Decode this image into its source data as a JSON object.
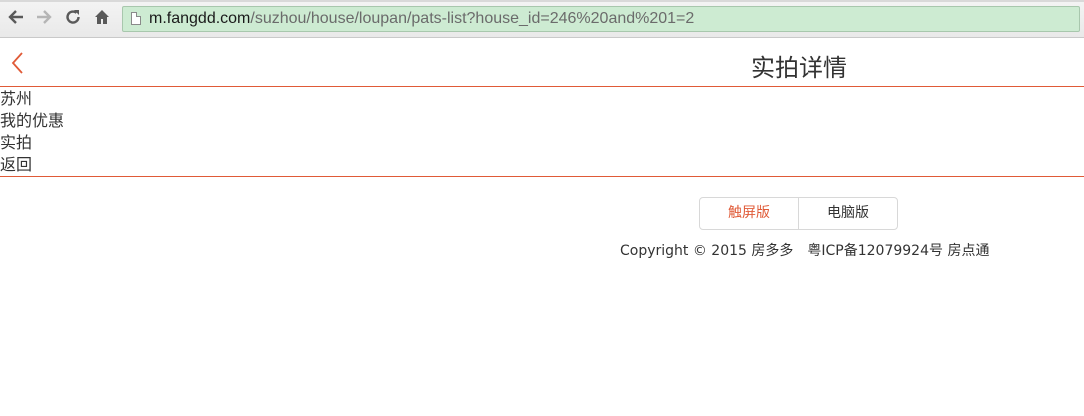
{
  "browser": {
    "back_glyph": "🡐",
    "forward_glyph": "🡒",
    "reload_glyph": "↻",
    "home_glyph": "⌂",
    "url_host": "m.fangdd.com",
    "url_path": "/suzhou/house/loupan/pats-list?house_id=246%20and%201=2",
    "omnibox_color": "#cdebd2"
  },
  "header": {
    "back_icon": "chevron-left-icon",
    "title": "实拍详情",
    "accent_color": "#e05a37"
  },
  "nav": {
    "items": [
      {
        "label": "苏州"
      },
      {
        "label": "我的优惠"
      },
      {
        "label": "实拍"
      },
      {
        "label": "返回"
      }
    ]
  },
  "footer": {
    "touch_label": "触屏版",
    "pc_label": "电脑版",
    "copyright": "Copyright © 2015 房多多",
    "icp": "粤ICP备12079924号 房点通"
  }
}
